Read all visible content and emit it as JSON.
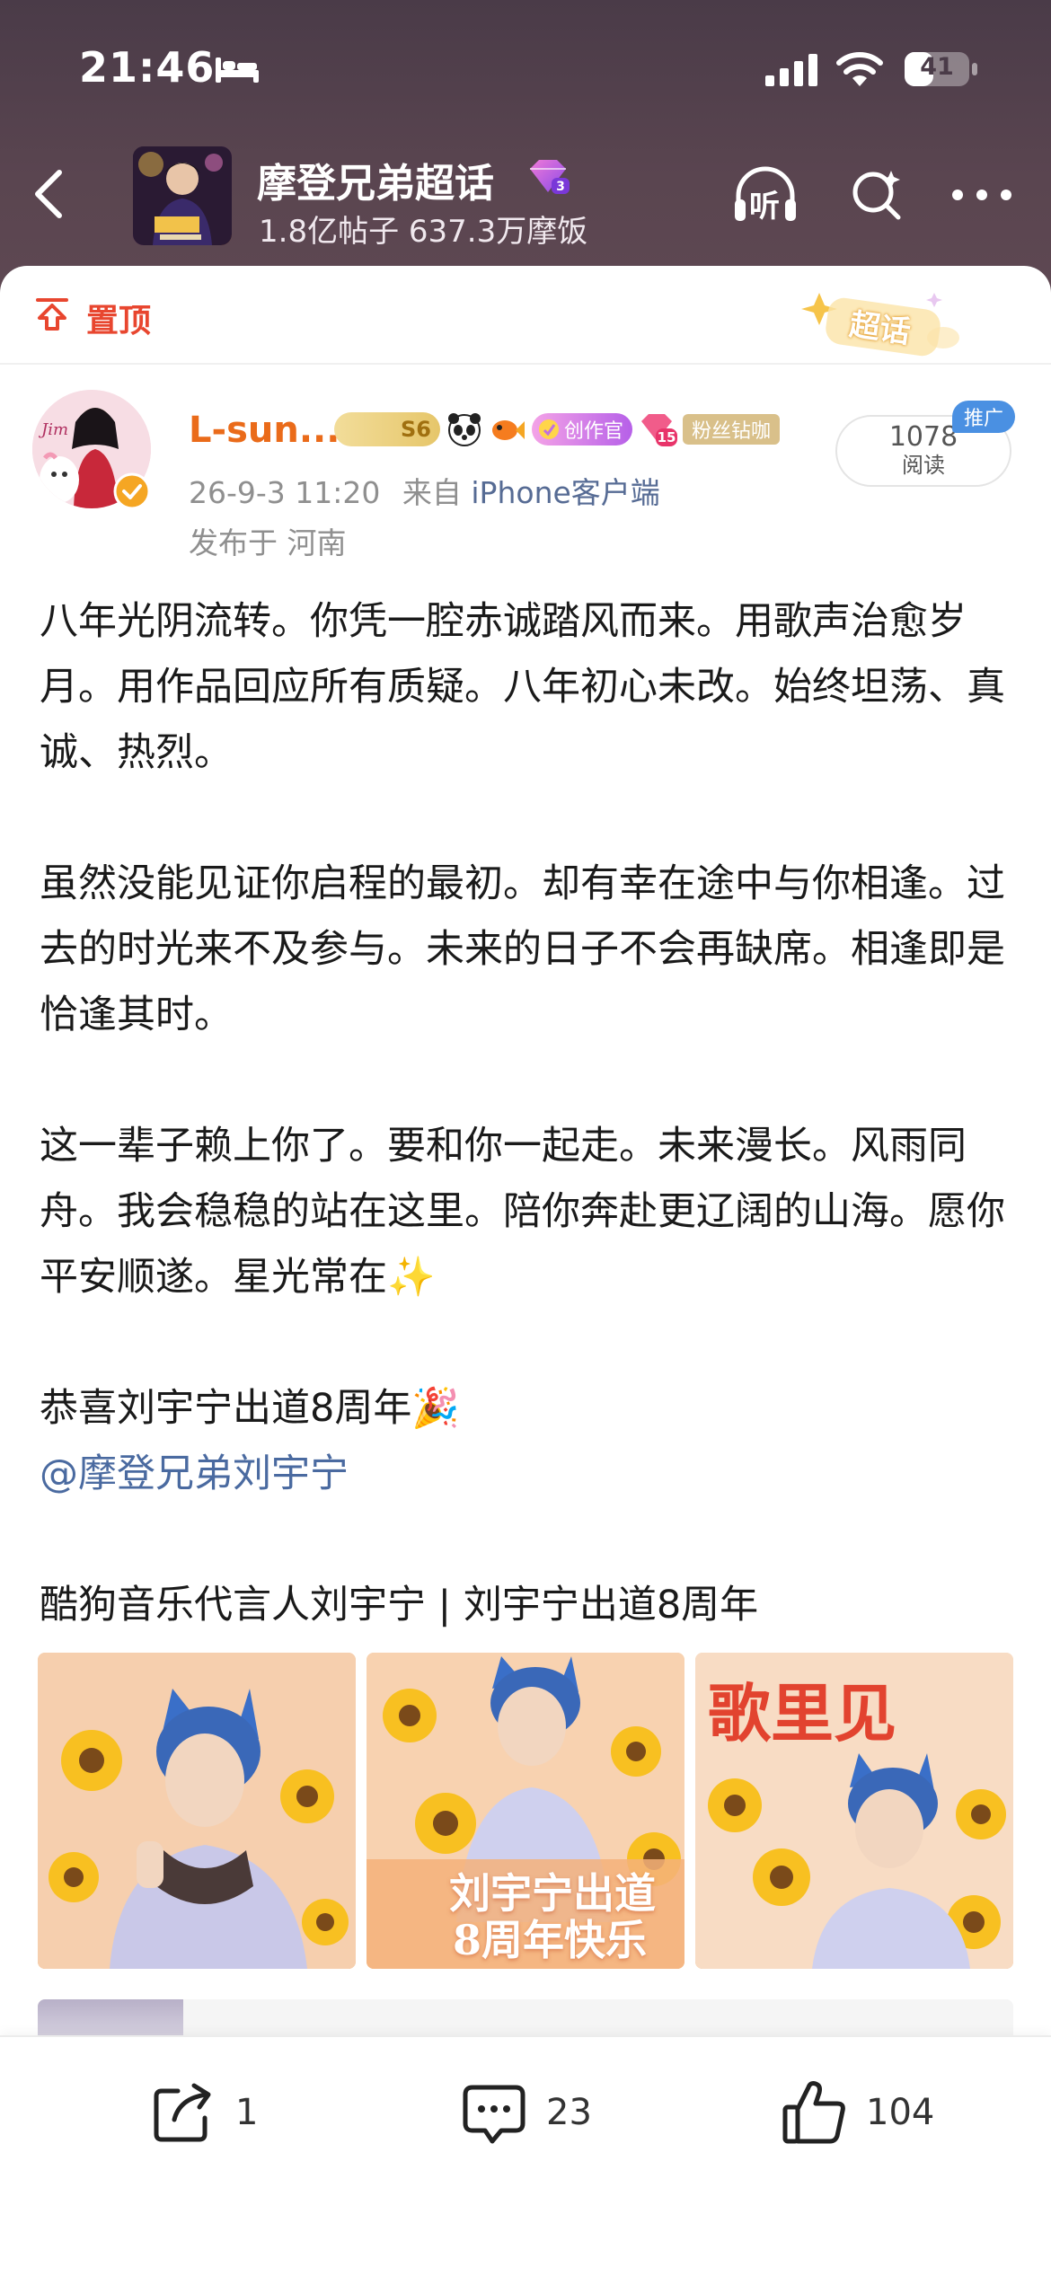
{
  "status_bar": {
    "time": "21:46",
    "battery": "41"
  },
  "header": {
    "group_name": "摩登兄弟超话",
    "group_stats": "1.8亿帖子 637.3万摩饭",
    "listen_label": "听"
  },
  "pin": {
    "label": "置顶",
    "chaohua_badge": "超话"
  },
  "post": {
    "username": "L-sun...",
    "badge_level": "S6",
    "badge_creator": "创作官",
    "badge_level_num": "15",
    "badge_fan": "粉丝钻咖",
    "meta_time": "26-9-3 11:20",
    "meta_from": "来自",
    "meta_source": "iPhone客户端",
    "location": "发布于 河南",
    "reads_count": "1078",
    "reads_label": "阅读",
    "promo_tag": "推广",
    "paragraphs": {
      "p1": "八年光阴流转。你凭一腔赤诚踏风而来。用歌声治愈岁月。用作品回应所有质疑。八年初心未改。始终坦荡、真诚、热烈。",
      "p2": "虽然没能见证你启程的最初。却有幸在途中与你相逢。过去的时光来不及参与。未来的日子不会再缺席。相逢即是恰逢其时。",
      "p3": "这一辈子赖上你了。要和你一起走。未来漫长。风雨同舟。我会稳稳的站在这里。陪你奔赴更辽阔的山海。愿你平安顺遂。星光常在✨",
      "p4": "恭喜刘宇宁出道8周年🎉",
      "mention": "@摩登兄弟刘宇宁",
      "p5": "酷狗音乐代言人刘宇宁 | 刘宇宁出道8周年"
    },
    "photo_captions": {
      "photo2_line1": "刘宇宁出道",
      "photo2_line2": "8周年快乐",
      "photo3_title": "歌里见"
    }
  },
  "actions": {
    "share_count": "1",
    "comment_count": "23",
    "like_count": "104"
  }
}
